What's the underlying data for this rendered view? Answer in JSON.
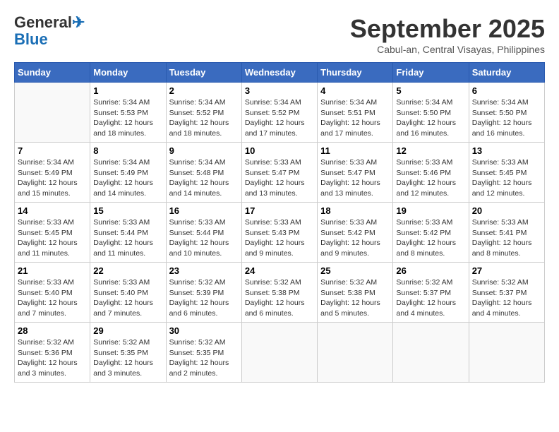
{
  "header": {
    "logo_general": "General",
    "logo_blue": "Blue",
    "month": "September 2025",
    "location": "Cabul-an, Central Visayas, Philippines"
  },
  "days_of_week": [
    "Sunday",
    "Monday",
    "Tuesday",
    "Wednesday",
    "Thursday",
    "Friday",
    "Saturday"
  ],
  "weeks": [
    [
      {
        "day": "",
        "info": ""
      },
      {
        "day": "1",
        "info": "Sunrise: 5:34 AM\nSunset: 5:53 PM\nDaylight: 12 hours\nand 18 minutes."
      },
      {
        "day": "2",
        "info": "Sunrise: 5:34 AM\nSunset: 5:52 PM\nDaylight: 12 hours\nand 18 minutes."
      },
      {
        "day": "3",
        "info": "Sunrise: 5:34 AM\nSunset: 5:52 PM\nDaylight: 12 hours\nand 17 minutes."
      },
      {
        "day": "4",
        "info": "Sunrise: 5:34 AM\nSunset: 5:51 PM\nDaylight: 12 hours\nand 17 minutes."
      },
      {
        "day": "5",
        "info": "Sunrise: 5:34 AM\nSunset: 5:50 PM\nDaylight: 12 hours\nand 16 minutes."
      },
      {
        "day": "6",
        "info": "Sunrise: 5:34 AM\nSunset: 5:50 PM\nDaylight: 12 hours\nand 16 minutes."
      }
    ],
    [
      {
        "day": "7",
        "info": "Sunrise: 5:34 AM\nSunset: 5:49 PM\nDaylight: 12 hours\nand 15 minutes."
      },
      {
        "day": "8",
        "info": "Sunrise: 5:34 AM\nSunset: 5:49 PM\nDaylight: 12 hours\nand 14 minutes."
      },
      {
        "day": "9",
        "info": "Sunrise: 5:34 AM\nSunset: 5:48 PM\nDaylight: 12 hours\nand 14 minutes."
      },
      {
        "day": "10",
        "info": "Sunrise: 5:33 AM\nSunset: 5:47 PM\nDaylight: 12 hours\nand 13 minutes."
      },
      {
        "day": "11",
        "info": "Sunrise: 5:33 AM\nSunset: 5:47 PM\nDaylight: 12 hours\nand 13 minutes."
      },
      {
        "day": "12",
        "info": "Sunrise: 5:33 AM\nSunset: 5:46 PM\nDaylight: 12 hours\nand 12 minutes."
      },
      {
        "day": "13",
        "info": "Sunrise: 5:33 AM\nSunset: 5:45 PM\nDaylight: 12 hours\nand 12 minutes."
      }
    ],
    [
      {
        "day": "14",
        "info": "Sunrise: 5:33 AM\nSunset: 5:45 PM\nDaylight: 12 hours\nand 11 minutes."
      },
      {
        "day": "15",
        "info": "Sunrise: 5:33 AM\nSunset: 5:44 PM\nDaylight: 12 hours\nand 11 minutes."
      },
      {
        "day": "16",
        "info": "Sunrise: 5:33 AM\nSunset: 5:44 PM\nDaylight: 12 hours\nand 10 minutes."
      },
      {
        "day": "17",
        "info": "Sunrise: 5:33 AM\nSunset: 5:43 PM\nDaylight: 12 hours\nand 9 minutes."
      },
      {
        "day": "18",
        "info": "Sunrise: 5:33 AM\nSunset: 5:42 PM\nDaylight: 12 hours\nand 9 minutes."
      },
      {
        "day": "19",
        "info": "Sunrise: 5:33 AM\nSunset: 5:42 PM\nDaylight: 12 hours\nand 8 minutes."
      },
      {
        "day": "20",
        "info": "Sunrise: 5:33 AM\nSunset: 5:41 PM\nDaylight: 12 hours\nand 8 minutes."
      }
    ],
    [
      {
        "day": "21",
        "info": "Sunrise: 5:33 AM\nSunset: 5:40 PM\nDaylight: 12 hours\nand 7 minutes."
      },
      {
        "day": "22",
        "info": "Sunrise: 5:33 AM\nSunset: 5:40 PM\nDaylight: 12 hours\nand 7 minutes."
      },
      {
        "day": "23",
        "info": "Sunrise: 5:32 AM\nSunset: 5:39 PM\nDaylight: 12 hours\nand 6 minutes."
      },
      {
        "day": "24",
        "info": "Sunrise: 5:32 AM\nSunset: 5:38 PM\nDaylight: 12 hours\nand 6 minutes."
      },
      {
        "day": "25",
        "info": "Sunrise: 5:32 AM\nSunset: 5:38 PM\nDaylight: 12 hours\nand 5 minutes."
      },
      {
        "day": "26",
        "info": "Sunrise: 5:32 AM\nSunset: 5:37 PM\nDaylight: 12 hours\nand 4 minutes."
      },
      {
        "day": "27",
        "info": "Sunrise: 5:32 AM\nSunset: 5:37 PM\nDaylight: 12 hours\nand 4 minutes."
      }
    ],
    [
      {
        "day": "28",
        "info": "Sunrise: 5:32 AM\nSunset: 5:36 PM\nDaylight: 12 hours\nand 3 minutes."
      },
      {
        "day": "29",
        "info": "Sunrise: 5:32 AM\nSunset: 5:35 PM\nDaylight: 12 hours\nand 3 minutes."
      },
      {
        "day": "30",
        "info": "Sunrise: 5:32 AM\nSunset: 5:35 PM\nDaylight: 12 hours\nand 2 minutes."
      },
      {
        "day": "",
        "info": ""
      },
      {
        "day": "",
        "info": ""
      },
      {
        "day": "",
        "info": ""
      },
      {
        "day": "",
        "info": ""
      }
    ]
  ]
}
